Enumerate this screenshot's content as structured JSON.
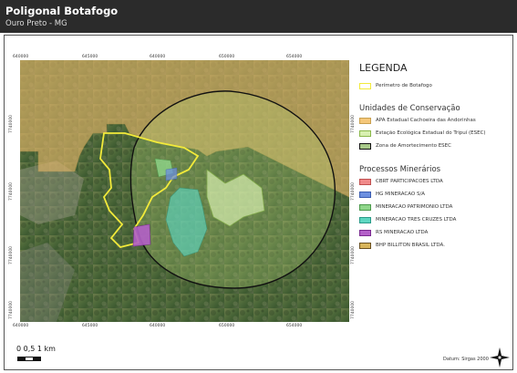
{
  "header": {
    "title": "Poligonal Botafogo",
    "subtitle": "Ouro Preto - MG"
  },
  "map": {
    "grid_x_labels": [
      "640000",
      "645000",
      "640000",
      "650000",
      "654000"
    ],
    "grid_y_labels": [
      "7740000",
      "7740000",
      "7740000",
      "7740000"
    ],
    "right_y_labels": [
      "7740000",
      "7740000",
      "7740000",
      "7740000"
    ]
  },
  "legend": {
    "title": "LEGENDA",
    "perimeter": {
      "label": "Perímetro de Botafogo",
      "color": "#f2ea3a"
    },
    "uc_title": "Unidades de Conservação",
    "uc_items": [
      {
        "label": "APA Estadual Cachoeira das Andorinhas",
        "fill": "#f5c77a",
        "border": "#c8a050"
      },
      {
        "label": "Estação Ecológica Estadual do Tripuí (ESEC)",
        "fill": "#d8f0b0",
        "border": "#8ab84a"
      },
      {
        "label": "Zona de Amortecimento ESEC",
        "fill": "#a9c98a",
        "border": "#111111"
      }
    ],
    "pm_title": "Processos Minerários",
    "pm_items": [
      {
        "label": "CBRT PARTICIPACOES LTDA",
        "fill": "#f08a8a",
        "border": "#c05050"
      },
      {
        "label": "HG MINERACAO S/A",
        "fill": "#6c8fe0",
        "border": "#3a5cb0"
      },
      {
        "label": "MINERACAO PATRIMONIO LTDA",
        "fill": "#8fd68a",
        "border": "#4a9a4a"
      },
      {
        "label": "MINERACAO TRES CRUZES LTDA",
        "fill": "#5ed6c0",
        "border": "#2a9a88"
      },
      {
        "label": "RS MINERACAO LTDA",
        "fill": "#b460c8",
        "border": "#7a2a90"
      },
      {
        "label": "BHP BILLITON BRASIL LTDA.",
        "fill": "#d8b45a",
        "border": "#6a5020"
      }
    ]
  },
  "scale": {
    "label": "0   0,5   1 km"
  },
  "footer": {
    "datum": "Datum: Sirgas 2000"
  }
}
